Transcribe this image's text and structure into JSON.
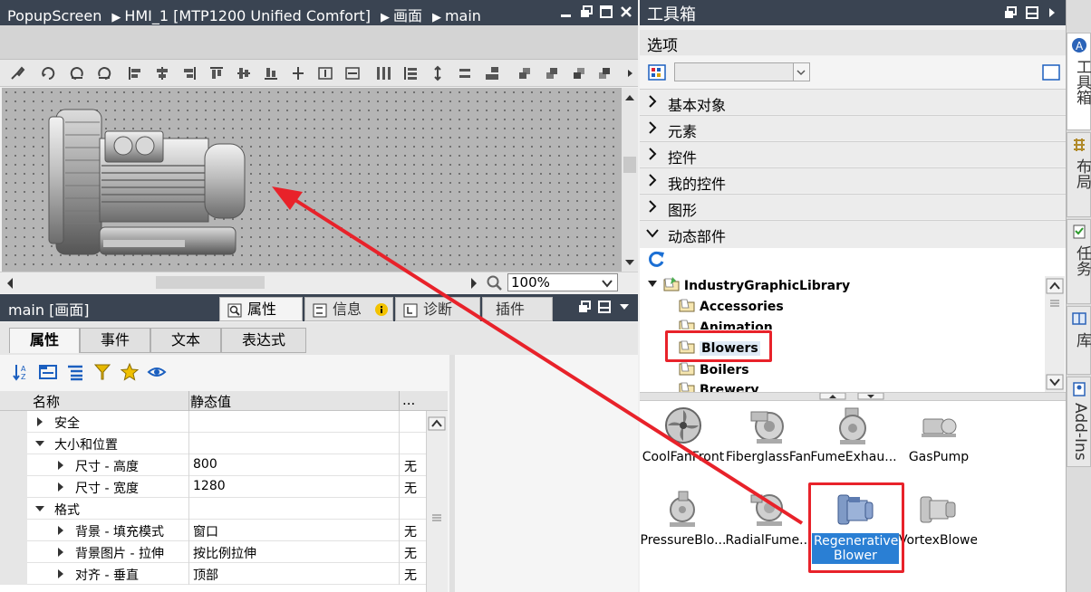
{
  "editor": {
    "breadcrumb": [
      "PopupScreen",
      "HMI_1 [MTP1200 Unified Comfort]",
      "画面",
      "main"
    ],
    "zoom": "100%"
  },
  "properties": {
    "title": "main [画面]",
    "tabs": [
      "属性",
      "信息",
      "诊断",
      "插件"
    ],
    "subtabs": [
      "属性",
      "事件",
      "文本",
      "表达式"
    ],
    "columns": [
      "名称",
      "静态值",
      "..."
    ],
    "rows": [
      {
        "label": "安全",
        "value": "",
        "unit": "",
        "level": 1,
        "expanded": false
      },
      {
        "label": "大小和位置",
        "value": "",
        "unit": "",
        "level": 0,
        "expanded": true
      },
      {
        "label": "尺寸 - 高度",
        "value": "800",
        "unit": "无",
        "level": 2,
        "expanded": false
      },
      {
        "label": "尺寸 - 宽度",
        "value": "1280",
        "unit": "无",
        "level": 2,
        "expanded": false
      },
      {
        "label": "格式",
        "value": "",
        "unit": "",
        "level": 0,
        "expanded": true
      },
      {
        "label": "背景 - 填充模式",
        "value": "窗口",
        "unit": "无",
        "level": 2,
        "expanded": false
      },
      {
        "label": "背景图片 - 拉伸",
        "value": "按比例拉伸",
        "unit": "无",
        "level": 2,
        "expanded": false
      },
      {
        "label": "对齐 - 垂直",
        "value": "顶部",
        "unit": "无",
        "level": 2,
        "expanded": false
      }
    ]
  },
  "toolbox": {
    "title": "工具箱",
    "options_label": "选项",
    "categories": [
      {
        "label": "基本对象",
        "expanded": false
      },
      {
        "label": "元素",
        "expanded": false
      },
      {
        "label": "控件",
        "expanded": false
      },
      {
        "label": "我的控件",
        "expanded": false
      },
      {
        "label": "图形",
        "expanded": false
      },
      {
        "label": "动态部件",
        "expanded": true
      }
    ],
    "tree": {
      "root": "IndustryGraphicLibrary",
      "children": [
        "Accessories",
        "Animation",
        "Blowers",
        "Boilers",
        "Brewery"
      ]
    },
    "gallery": [
      {
        "label": "CoolFanFront"
      },
      {
        "label": "FiberglassFan"
      },
      {
        "label": "FumeExhau..."
      },
      {
        "label": "GasPump"
      },
      {
        "label": "PressureBlo..."
      },
      {
        "label": "RadialFume..."
      },
      {
        "label": "Regenerative Blower"
      },
      {
        "label": "VortexBlower"
      }
    ]
  },
  "side_tabs": [
    "工具箱",
    "布局",
    "任务",
    "库",
    "Add-Ins"
  ],
  "colors": {
    "title_bar": "#3a4452",
    "annotation": "#e8222a",
    "selection": "#2a7fd4"
  }
}
